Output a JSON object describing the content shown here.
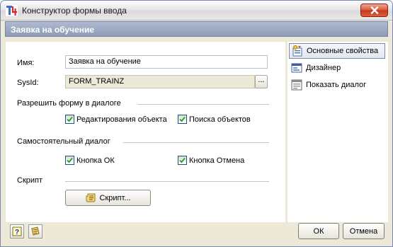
{
  "window": {
    "title": "Конструктор формы ввода",
    "close_icon": "close-x-icon"
  },
  "header": {
    "title": "Заявка на обучение"
  },
  "form": {
    "name_label": "Имя:",
    "name_value": "Заявка на обучение",
    "sysid_label": "SysId:",
    "sysid_value": "FORM_TRAINZ",
    "ellipsis_label": "...",
    "allow_group": {
      "title": "Разрешить форму в диалоге",
      "edit_objects": {
        "label": "Редактирования объекта",
        "checked": true
      },
      "search_objects": {
        "label": "Поиска объектов",
        "checked": true
      }
    },
    "standalone_group": {
      "title": "Самостоятельный диалог",
      "ok_button": {
        "label": "Кнопка ОК",
        "checked": true
      },
      "cancel_button": {
        "label": "Кнопка Отмена",
        "checked": true
      }
    },
    "script_group": {
      "title": "Скрипт",
      "button_label": "Скрипт..."
    }
  },
  "nav": {
    "items": [
      {
        "label": "Основные свойства",
        "icon": "properties-icon",
        "selected": true
      },
      {
        "label": "Дизайнер",
        "icon": "designer-icon",
        "selected": false
      },
      {
        "label": "Показать диалог",
        "icon": "show-dialog-icon",
        "selected": false
      }
    ]
  },
  "footer": {
    "ok_label": "ОК",
    "cancel_label": "Отмена",
    "help_icon": "help-icon",
    "script_icon": "script-icon"
  },
  "colors": {
    "header_bar": "#8d9bb6",
    "window_bg": "#ece9d8",
    "close_button": "#c5381a",
    "check_mark": "#21a121"
  }
}
